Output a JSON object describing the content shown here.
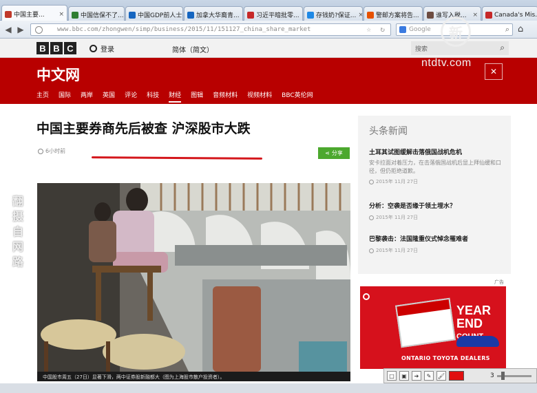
{
  "browser": {
    "tabs": [
      {
        "title": "中国主要...",
        "color": "#c0392b",
        "active": true
      },
      {
        "title": "中国信保不了...",
        "color": "#2e7d32"
      },
      {
        "title": "中国GDP前人士...",
        "color": "#1565c0"
      },
      {
        "title": "加拿大华裔青...",
        "color": "#1565c0"
      },
      {
        "title": "习近平暗批零...",
        "color": "#c62828"
      },
      {
        "title": "存钱奶?保证...",
        "color": "#1e88e5"
      },
      {
        "title": "警邮方案将告...",
        "color": "#e65100"
      },
      {
        "title": "谁写入税...",
        "color": "#6d4c41"
      },
      {
        "title": "Canada's Mis...",
        "color": "#c62828"
      }
    ],
    "url": "www.bbc.com/zhongwen/simp/business/2015/11/151127_china_share_market",
    "search_placeholder": "Google"
  },
  "bbc_bar": {
    "logo_letters": [
      "B",
      "B",
      "C"
    ],
    "signin_label": "登录",
    "language_label": "简体（简文）",
    "search_placeholder": "搜索"
  },
  "masthead": {
    "title": "中文网",
    "nav": [
      "主页",
      "国际",
      "两岸",
      "英国",
      "评论",
      "科技",
      "财经",
      "图辑",
      "音频材料",
      "视频材料",
      "BBC英伦网"
    ],
    "current_nav": "财经"
  },
  "overlay": {
    "ntd_logo": "新",
    "ntd_text": "ntdtv.com",
    "side_watermark": "翻摄自网路"
  },
  "article": {
    "headline": "中国主要券商先后被查 沪深股市大跌",
    "timestamp": "6小时前",
    "share_label": "分享",
    "caption": "中国股市周五（27日）显著下滑，两中证券股新融都大（图为上海股市散户投资者）。"
  },
  "sidebar": {
    "title": "头条新闻",
    "items": [
      {
        "title": "土耳其试图缓解击落俄国战机危机",
        "summary": "安卡拉面对着压力，在击落俄国战机后显上拜仙缓和口径，但仍拒绝道歉。",
        "date": "2015年 11月 27日"
      },
      {
        "title": "分析：空袭是否缘于领土埋水？",
        "summary": "",
        "date": "2015年 11月 27日"
      },
      {
        "title": "巴黎袭击：法国隆重仪式悼念罹难者",
        "summary": "",
        "date": "2015年 11月 27日"
      }
    ]
  },
  "ad": {
    "label": "广告",
    "headline_line1": "YEAR",
    "headline_line2": "END",
    "headline_line3": "COUNT",
    "dealers": "ONTARIO TOYOTA DEALERS"
  },
  "floatbar": {
    "number": "3",
    "color": "#e01010"
  }
}
